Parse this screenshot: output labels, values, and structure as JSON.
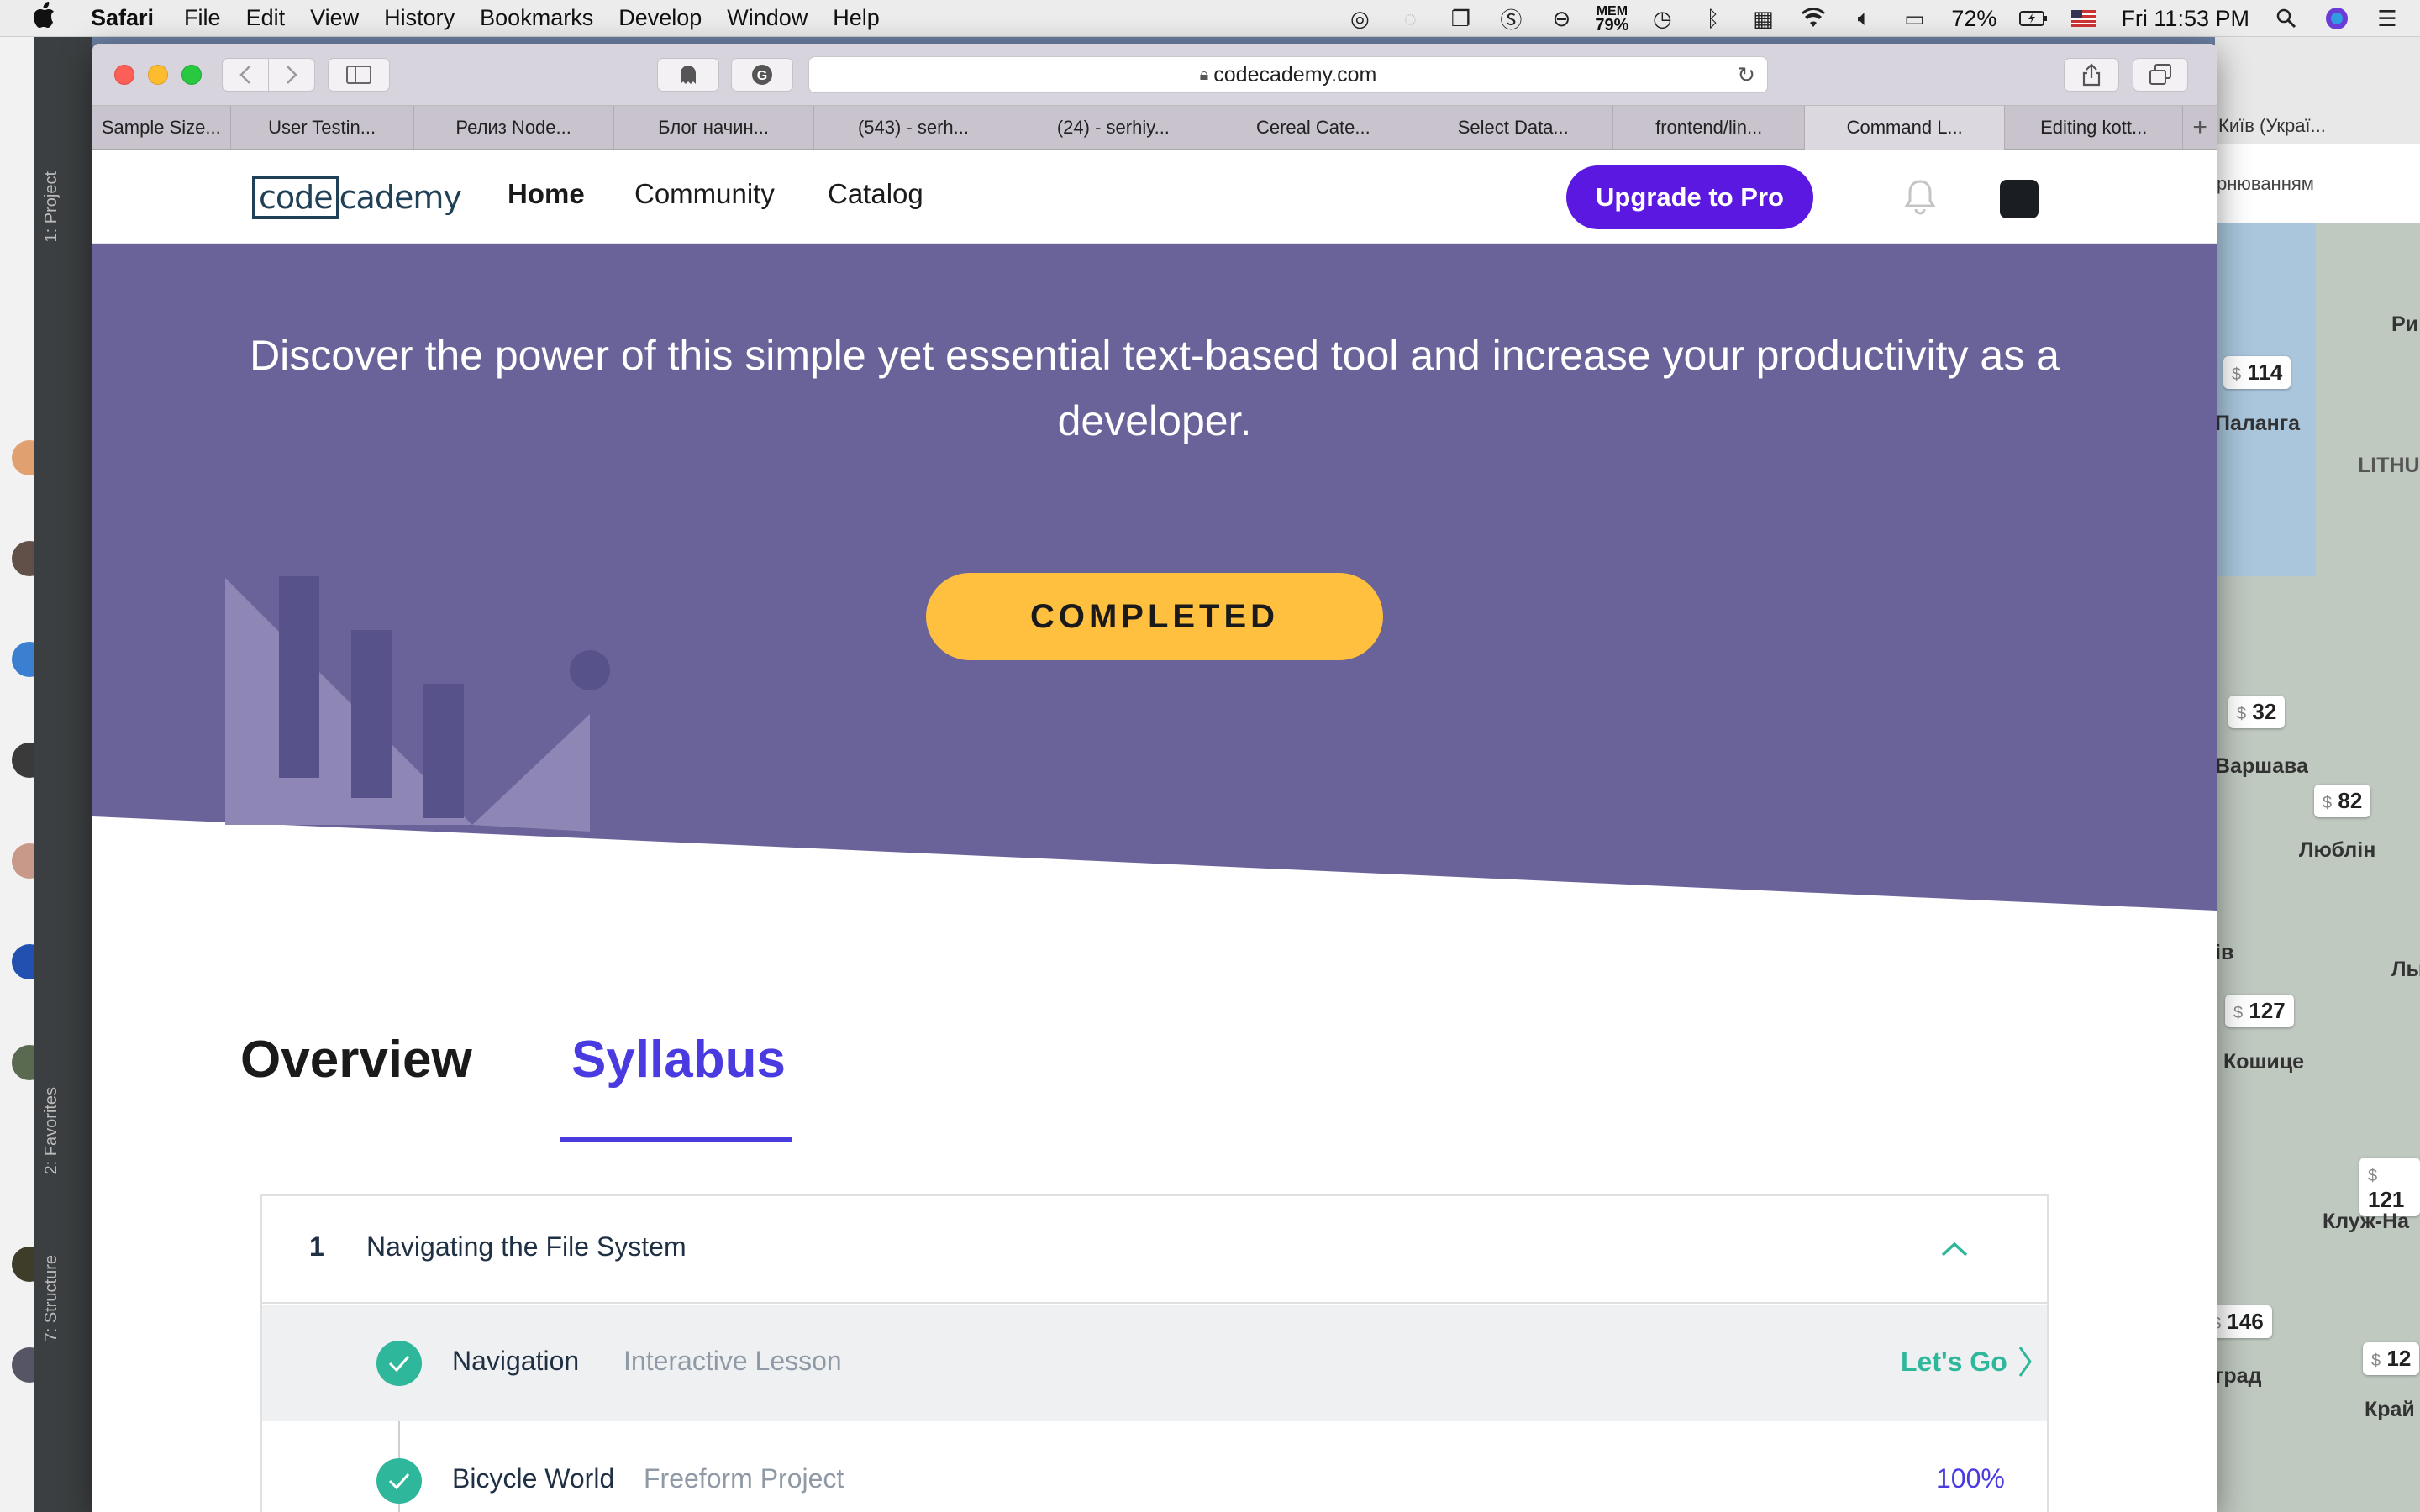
{
  "menubar": {
    "app": "Safari",
    "items": [
      "File",
      "Edit",
      "View",
      "History",
      "Bookmarks",
      "Develop",
      "Window",
      "Help"
    ],
    "mem_label": "MEM",
    "mem_value": "79%",
    "battery": "72%",
    "clock": "Fri 11:53 PM"
  },
  "ide": {
    "project_tab": "1: Project",
    "favorites_tab": "2: Favorites",
    "structure_tab": "7: Structure"
  },
  "browser": {
    "url": "codecademy.com",
    "tabs": [
      {
        "label": "Sample Size..."
      },
      {
        "label": "User Testin..."
      },
      {
        "label": "Релиз Node..."
      },
      {
        "label": "Блог начин..."
      },
      {
        "label": "(543) - serh..."
      },
      {
        "label": "(24) - serhiy..."
      },
      {
        "label": "Cereal Cate..."
      },
      {
        "label": "Select Data..."
      },
      {
        "label": "frontend/lin..."
      },
      {
        "label": "Command L..."
      },
      {
        "label": "Editing kott..."
      }
    ],
    "new_tab_label": "+"
  },
  "bg_map": {
    "tab_label": "Київ (Украї...",
    "nav_text": "рнюванням",
    "prices": [
      {
        "symbol": "$",
        "value": "114"
      },
      {
        "symbol": "$",
        "value": "32"
      },
      {
        "symbol": "$",
        "value": "82"
      },
      {
        "symbol": "$",
        "value": "127"
      },
      {
        "symbol": "$",
        "value": "121"
      },
      {
        "symbol": "$",
        "value": "146"
      },
      {
        "symbol": "$",
        "value": "12"
      }
    ],
    "cities": [
      "Паланга",
      "LITHU",
      "Варшава",
      "Люблін",
      "Кошице",
      "Клуж-На",
      "град",
      "Край",
      "Ри",
      "ів",
      "Лы"
    ]
  },
  "site": {
    "logo_code": "code",
    "logo_rest": "cademy",
    "nav": {
      "home": "Home",
      "community": "Community",
      "catalog": "Catalog",
      "upgrade": "Upgrade to Pro"
    },
    "hero": {
      "description": "Discover the power of this simple yet essential text-based tool and increase your productivity as a developer.",
      "status_button": "COMPLETED"
    },
    "page_tabs": {
      "overview": "Overview",
      "syllabus": "Syllabus",
      "active": "Syllabus"
    },
    "syllabus": {
      "module_number": "1",
      "module_title": "Navigating the File System",
      "lessons": [
        {
          "name": "Navigation",
          "type": "Interactive Lesson",
          "action": "Let's Go",
          "status": "completed"
        },
        {
          "name": "Bicycle World",
          "type": "Freeform Project",
          "progress": "100%",
          "status": "completed"
        }
      ]
    }
  },
  "colors": {
    "hero_bg": "#6a6399",
    "accent_purple": "#5a18e0",
    "syllabus_blue": "#4a3be0",
    "completed_yellow": "#ffc040",
    "check_green": "#2fb79b"
  }
}
